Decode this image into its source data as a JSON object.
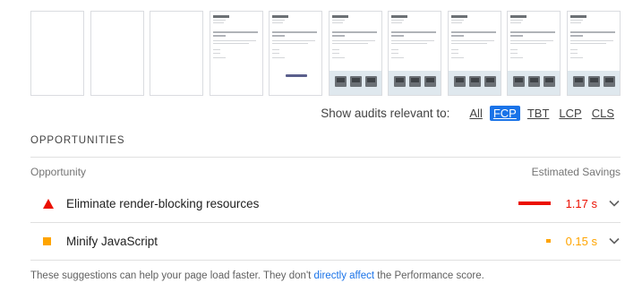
{
  "filter": {
    "label": "Show audits relevant to:",
    "options": [
      {
        "label": "All",
        "active": false
      },
      {
        "label": "FCP",
        "active": true
      },
      {
        "label": "TBT",
        "active": false
      },
      {
        "label": "LCP",
        "active": false
      },
      {
        "label": "CLS",
        "active": false
      }
    ]
  },
  "section": {
    "title": "OPPORTUNITIES"
  },
  "columns": {
    "left": "Opportunity",
    "right": "Estimated Savings"
  },
  "opportunities": [
    {
      "title": "Eliminate render-blocking resources",
      "savings": "1.17 s",
      "savings_seconds": 1.17,
      "severity": "fail",
      "icon": "red-triangle-icon",
      "color": "#eb0f00"
    },
    {
      "title": "Minify JavaScript",
      "savings": "0.15 s",
      "savings_seconds": 0.15,
      "severity": "average",
      "icon": "orange-square-icon",
      "color": "#ffa400"
    }
  ],
  "footer": {
    "prefix": "These suggestions can help your page load faster. They don't ",
    "link": "directly affect",
    "suffix": " the Performance score."
  },
  "filmstrip": {
    "frame_count": 10,
    "blank_frames": 3
  },
  "colors": {
    "accent": "#1a73e8",
    "fail": "#eb0f00",
    "average": "#ffa400"
  }
}
